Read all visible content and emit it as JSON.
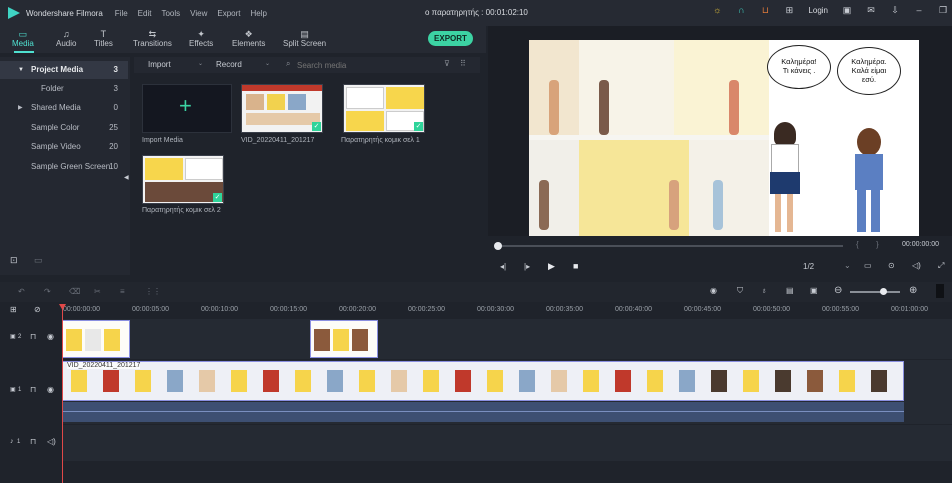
{
  "titlebar": {
    "app_title": "Wondershare Filmora",
    "menu": [
      "File",
      "Edit",
      "Tools",
      "View",
      "Export",
      "Help"
    ],
    "project": "ο παρατηρητής : 00:01:02:10",
    "login": "Login"
  },
  "toolbar": {
    "tools": [
      {
        "label": "Media",
        "glyph": "▭"
      },
      {
        "label": "Audio",
        "glyph": "♫"
      },
      {
        "label": "Titles",
        "glyph": "T"
      },
      {
        "label": "Transitions",
        "glyph": "⇆"
      },
      {
        "label": "Effects",
        "glyph": "✦"
      },
      {
        "label": "Elements",
        "glyph": "❖"
      },
      {
        "label": "Split Screen",
        "glyph": "▤"
      }
    ],
    "export_label": "EXPORT"
  },
  "sidebar": {
    "items": [
      {
        "label": "Project Media",
        "count": "3"
      },
      {
        "label": "Folder",
        "count": "3"
      },
      {
        "label": "Shared Media",
        "count": "0"
      },
      {
        "label": "Sample Color",
        "count": "25"
      },
      {
        "label": "Sample Video",
        "count": "20"
      },
      {
        "label": "Sample Green Screen",
        "count": "10"
      }
    ]
  },
  "mediabar": {
    "import_label": "Import",
    "record_label": "Record",
    "search_placeholder": "Search media"
  },
  "media": {
    "import_label": "Import Media",
    "items": [
      {
        "label": "VID_20220411_201217"
      },
      {
        "label": "Παρατηρητής κομικ σελ 1"
      },
      {
        "label": "Παρατηρητής κομικ σελ 2"
      }
    ]
  },
  "preview": {
    "bubble1": "Καλημέρα!\nΤι κάνεις .",
    "bubble2": "Καλημέρα.\nΚαλά είμαι\nεσύ.",
    "timecode": "00:00:00:00",
    "quality": "1/2"
  },
  "ruler": {
    "ticks": [
      "00:00:00:00",
      "00:00:05:00",
      "00:00:10:00",
      "00:00:15:00",
      "00:00:20:00",
      "00:00:25:00",
      "00:00:30:00",
      "00:00:35:00",
      "00:00:40:00",
      "00:00:45:00",
      "00:00:50:00",
      "00:00:55:00",
      "00:01:00:00"
    ]
  },
  "tracks": {
    "v2_label": "2",
    "v1_label": "1",
    "a1_label": "1",
    "v1_clip_label": "VID_20220411_201217"
  },
  "colors": {
    "accent": "#3cd3a3",
    "teal": "#4fe0d0",
    "clip_border": "#8a8fe0",
    "playhead": "#e04848"
  }
}
